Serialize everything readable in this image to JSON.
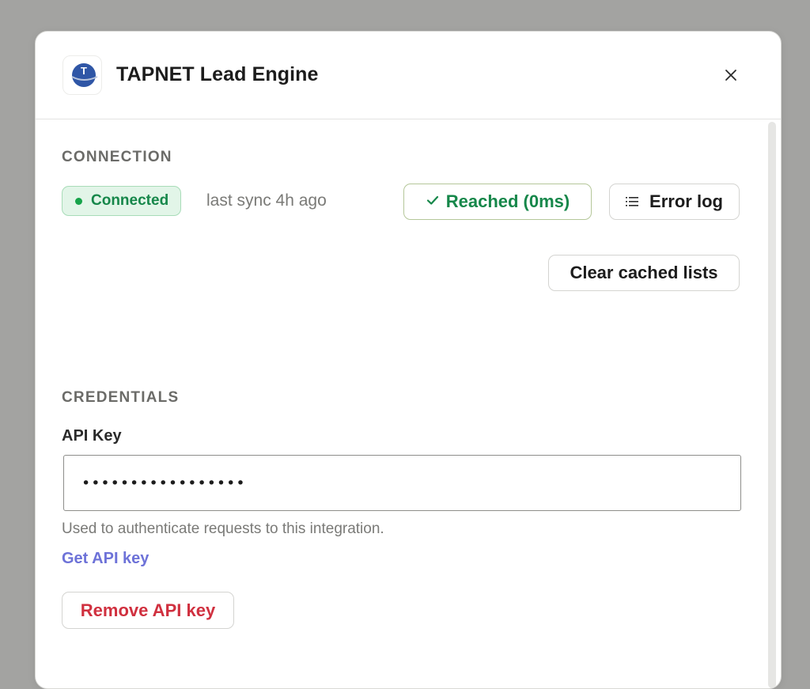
{
  "modal": {
    "title": "TAPNET Lead Engine",
    "logo_letter": "T"
  },
  "connection": {
    "section_label": "CONNECTION",
    "status": "Connected",
    "last_sync": "last sync 4h ago",
    "reached_label": "Reached (0ms)",
    "error_log_label": "Error log",
    "clear_cache_label": "Clear cached lists"
  },
  "credentials": {
    "section_label": "CREDENTIALS",
    "api_key_label": "API Key",
    "api_key_value": "•••••••••••••••••",
    "help_text": "Used to authenticate requests to this integration.",
    "get_key_link": "Get API key",
    "remove_key_label": "Remove API key"
  },
  "colors": {
    "success": "#16874a",
    "danger": "#d0303f",
    "link": "#6d72d8"
  }
}
